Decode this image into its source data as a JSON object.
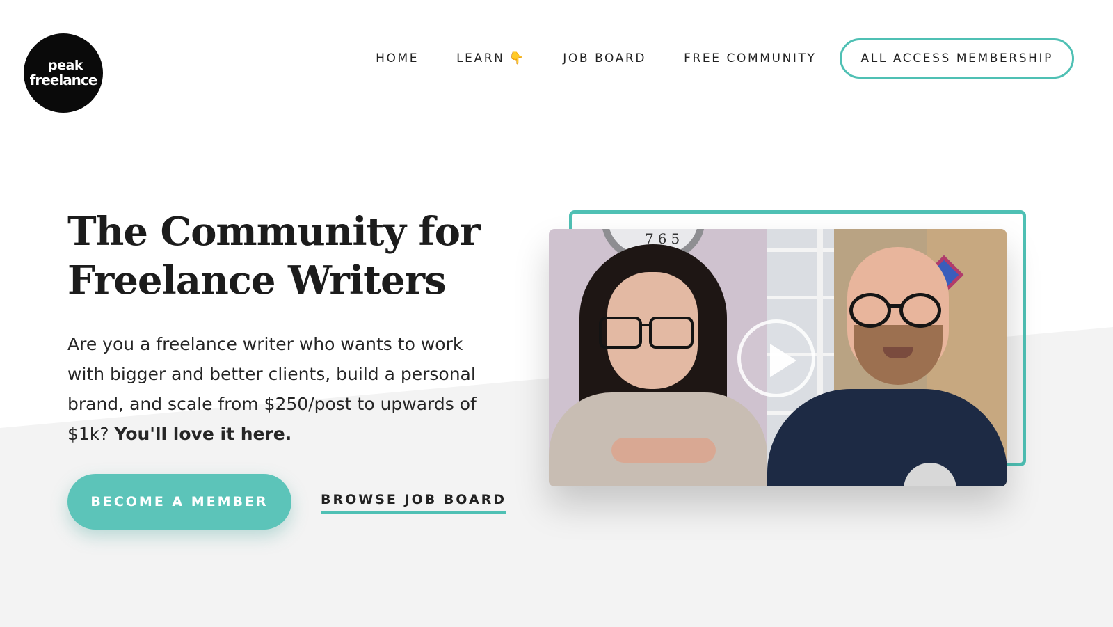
{
  "brand": {
    "logo_line1": "peak",
    "logo_line2": "freelance"
  },
  "nav": {
    "items": [
      {
        "label": "HOME"
      },
      {
        "label": "LEARN",
        "emoji": "👇"
      },
      {
        "label": "JOB BOARD"
      },
      {
        "label": "FREE COMMUNITY"
      }
    ],
    "cta_label": "ALL ACCESS MEMBERSHIP"
  },
  "hero": {
    "title_line1": "The Community for",
    "title_line2": "Freelance Writers",
    "subtitle": "Are you a freelance writer who wants to work with bigger and better clients, build a personal brand, and scale from $250/post to upwards of $1k?",
    "subtitle_emphasis": "You'll love it here.",
    "primary_button": "BECOME A MEMBER",
    "secondary_link": "BROWSE JOB BOARD"
  },
  "video": {
    "clock_digits": "765"
  },
  "colors": {
    "accent": "#4fc0b4",
    "button": "#5cc4b9",
    "text": "#1c1c1c",
    "band": "#f3f3f3"
  }
}
